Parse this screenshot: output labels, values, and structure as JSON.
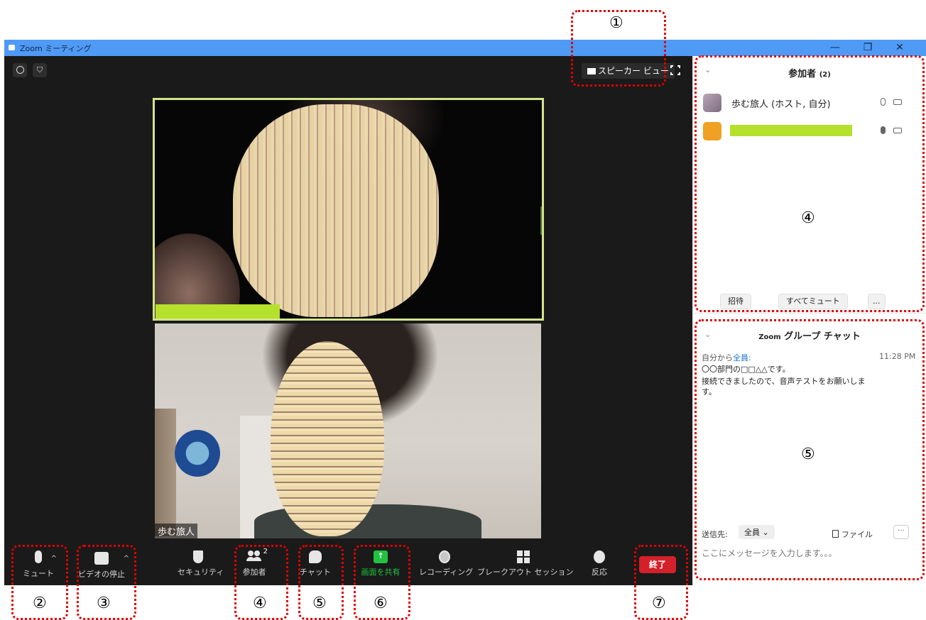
{
  "window": {
    "title": "Zoom ミーティング",
    "controls": [
      "—",
      "❐",
      "✕"
    ]
  },
  "meeting": {
    "top_icons": [
      "info-icon",
      "shield-icon"
    ],
    "view_button": "スピーカー ビュー",
    "self_name": "歩む旅人"
  },
  "toolbar": {
    "items": [
      {
        "key": "mute",
        "label": "ミュート",
        "icon": "microphone-icon"
      },
      {
        "key": "video",
        "label": "ビデオの停止",
        "icon": "camera-icon"
      },
      {
        "key": "security",
        "label": "セキュリティ",
        "icon": "shield-icon"
      },
      {
        "key": "participants",
        "label": "参加者",
        "icon": "people-icon",
        "count": "2"
      },
      {
        "key": "chat",
        "label": "チャット",
        "icon": "chat-bubble-icon"
      },
      {
        "key": "share",
        "label": "画面を共有",
        "icon": "share-arrow-icon",
        "accent": "#23c240"
      },
      {
        "key": "record",
        "label": "レコーディング",
        "icon": "record-icon"
      },
      {
        "key": "breakout",
        "label": "ブレークアウト セッション",
        "icon": "grid-icon"
      },
      {
        "key": "reactions",
        "label": "反応",
        "icon": "smiley-icon"
      }
    ],
    "end_label": "終了",
    "end_color": "#d4202a"
  },
  "participants": {
    "title": "参加者",
    "count": "(2)",
    "list": [
      {
        "name": "歩む旅人 (ホスト, 自分)"
      },
      {
        "name": ""
      }
    ],
    "buttons": [
      "招待",
      "すべてミュート",
      "..."
    ]
  },
  "chat": {
    "title_prefix": "Zoom",
    "title": "グループ チャット",
    "from": "自分から",
    "to": "全員:",
    "time": "11:28 PM",
    "message_line1": "〇〇部門の□□△△です。",
    "message_line2": "接続できましたので、音声テストをお願いしま",
    "message_line3": "す。",
    "send_to_label": "送信先:",
    "send_to_value": "全員 ⌄",
    "file_label": "ファイル",
    "more_label": "···",
    "placeholder": "ここにメッセージを入力します。。。"
  },
  "annotations": {
    "n1": "①",
    "n2": "②",
    "n3": "③",
    "n4a": "④",
    "n4b": "④",
    "n5a": "⑤",
    "n5b": "⑤",
    "n6": "⑥",
    "n7": "⑦",
    "color": "#e00000"
  }
}
